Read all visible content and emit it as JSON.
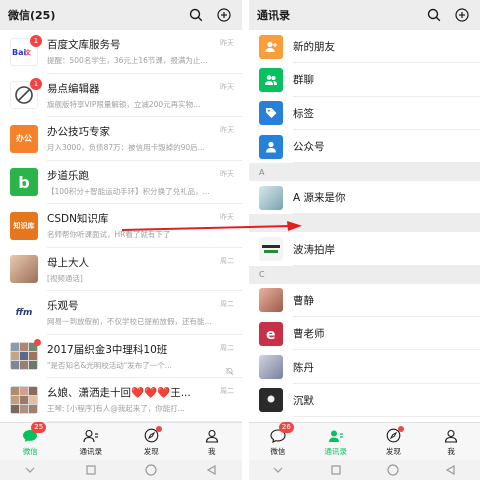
{
  "left": {
    "title": "微信(25)",
    "chats": [
      {
        "name": "百度文库服务号",
        "preview": "提醒：500名学生，36元上16节课，报满为止...",
        "time": "昨天",
        "avatar_text": "Bai文库",
        "avatar_color": "#ffffff",
        "badge": "1"
      },
      {
        "name": "易点编辑器",
        "preview": "旗舰版特享VIP限量解锁，立减200元再实物...",
        "time": "昨天",
        "avatar_text": "",
        "avatar_color": "#ffffff",
        "badge": "1"
      },
      {
        "name": "办公技巧专家",
        "preview": "月入3000，负债87万：被信用卡毁掉的90后...",
        "time": "昨天",
        "avatar_text": "办公",
        "avatar_color": "#f5822a",
        "badge": ""
      },
      {
        "name": "步道乐跑",
        "preview": "【100积分+智能运动手环】积分换了兑礼品，...",
        "time": "昨天",
        "avatar_text": "b",
        "avatar_color": "#2cb34a",
        "badge": ""
      },
      {
        "name": "CSDN知识库",
        "preview": "名师帮你听课面试，HR看了就有下了",
        "time": "昨天",
        "avatar_text": "知识库",
        "avatar_color": "#e5761e",
        "badge": ""
      },
      {
        "name": "母上大人",
        "preview": "[视频通话]",
        "time": "周二",
        "avatar_text": "",
        "avatar_color": "#c9a58a",
        "badge": ""
      },
      {
        "name": "乐观号",
        "preview": "网易一到放假前，不仅学校已提前放假，还有能...",
        "time": "周二",
        "avatar_text": "ffm",
        "avatar_color": "#ffffff",
        "badge": ""
      },
      {
        "name": "2017届织金3中理科10班",
        "preview": "\"是否知名&光明校活动\"发布了一个...",
        "time": "周二",
        "avatar_text": "",
        "avatar_color": "#8a9cb0",
        "badge": "",
        "dot": true,
        "muted": true
      },
      {
        "name": "幺娘、潇洒走十回❤️❤️❤️王...",
        "preview": "王琴: [小程序]有人@我起来了，你能打...",
        "time": "周二",
        "avatar_text": "",
        "avatar_color": "#b08c6e",
        "badge": ""
      }
    ],
    "tabs": [
      {
        "label": "微信",
        "badge": "25"
      },
      {
        "label": "通讯录"
      },
      {
        "label": "发现"
      },
      {
        "label": "我"
      }
    ]
  },
  "right": {
    "title": "通讯录",
    "top_items": [
      {
        "name": "新的朋友",
        "icon": "add-friend-icon",
        "color": "#fa9d3b"
      },
      {
        "name": "群聊",
        "icon": "group-chat-icon",
        "color": "#07c160"
      },
      {
        "name": "标签",
        "icon": "tag-icon",
        "color": "#2782d7"
      },
      {
        "name": "公众号",
        "icon": "official-account-icon",
        "color": "#2782d7"
      }
    ],
    "sections": [
      {
        "letter": "A",
        "contacts": [
          {
            "name": "A 源来是你",
            "color": "#9cc0c8"
          }
        ]
      },
      {
        "letter": "",
        "contacts": [
          {
            "name": "波涛拍岸",
            "color": "#f0f0f0"
          }
        ]
      },
      {
        "letter": "C",
        "contacts": [
          {
            "name": "曹静",
            "color": "#c88e7a"
          },
          {
            "name": "曹老师",
            "color": "#c8304a"
          },
          {
            "name": "陈丹",
            "color": "#9aa0b4"
          },
          {
            "name": "沉默",
            "color": "#2a2a2a"
          }
        ]
      }
    ],
    "tabs": [
      {
        "label": "微信",
        "badge": "26"
      },
      {
        "label": "通讯录"
      },
      {
        "label": "发现"
      },
      {
        "label": "我"
      }
    ]
  },
  "colors": {
    "accent": "#07c160",
    "badge": "#f24444",
    "arrow": "#e02020"
  }
}
